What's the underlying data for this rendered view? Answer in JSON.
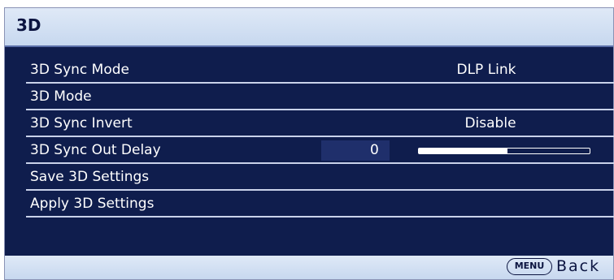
{
  "window": {
    "title": "3D"
  },
  "menu": {
    "items": [
      {
        "label": "3D Sync Mode",
        "value": "DLP Link"
      },
      {
        "label": "3D Mode",
        "value": ""
      },
      {
        "label": "3D Sync Invert",
        "value": "Disable"
      },
      {
        "label": "3D Sync Out Delay",
        "value": "0",
        "slider_fraction": 0.52
      },
      {
        "label": "Save 3D Settings",
        "value": ""
      },
      {
        "label": "Apply 3D Settings",
        "value": ""
      }
    ]
  },
  "footer": {
    "menu_key": "MENU",
    "back_label": "Back"
  },
  "colors": {
    "panel": "#0f1d4d",
    "header": "#d4e2f3",
    "text": "#ffffff",
    "header_text": "#0b1440"
  }
}
